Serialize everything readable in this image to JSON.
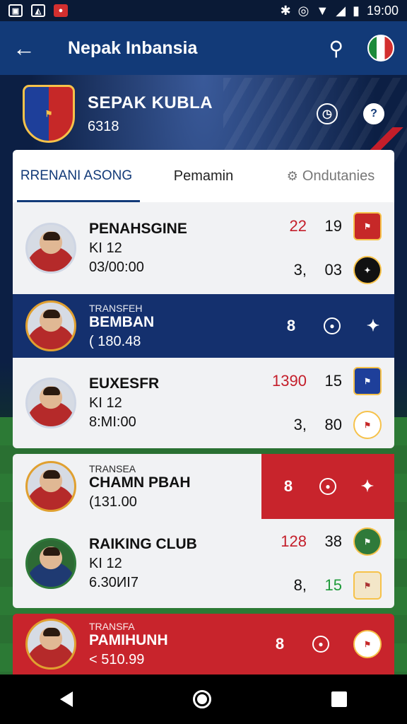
{
  "status_bar": {
    "time": "19:00"
  },
  "app_bar": {
    "title": "Nepak Inbansia"
  },
  "club": {
    "name": "SEPAK KUBLA",
    "sub": "6318"
  },
  "tabs": [
    {
      "label": "RRENANI ASONG",
      "active": true
    },
    {
      "label": "Pemamin",
      "active": false
    },
    {
      "label": "Ondutanies",
      "active": false
    }
  ],
  "rows": [
    {
      "name": "PENAHSGINE",
      "line1": "KI 12",
      "line2": "03/00:00",
      "s1": "22",
      "s2": "19",
      "s3": "3,",
      "s4": "03"
    },
    {
      "tag": "TRANSFEH",
      "name": "BEMBAN",
      "line1": "( 180.48"
    },
    {
      "name": "EUXESFR",
      "line1": "KI 12",
      "line2": "8:MI:00",
      "s1": "1390",
      "s2": "15",
      "s3": "3,",
      "s4": "80"
    },
    {
      "tag": "TRANSEA",
      "name": "CHAMN PBAH",
      "line1": "(131.00"
    },
    {
      "name": "RAIKING CLUB",
      "line1": "KI 12",
      "line2": "6.30ИI7",
      "s1": "128",
      "s2": "38",
      "s3": "8,",
      "s4": "15"
    },
    {
      "tag": "TRANSFA",
      "name": "PAMIHUNH",
      "line1": "< 510.99"
    }
  ],
  "colors": {
    "primary": "#123a78",
    "accent_red": "#c8242c",
    "navy": "#14306e"
  }
}
